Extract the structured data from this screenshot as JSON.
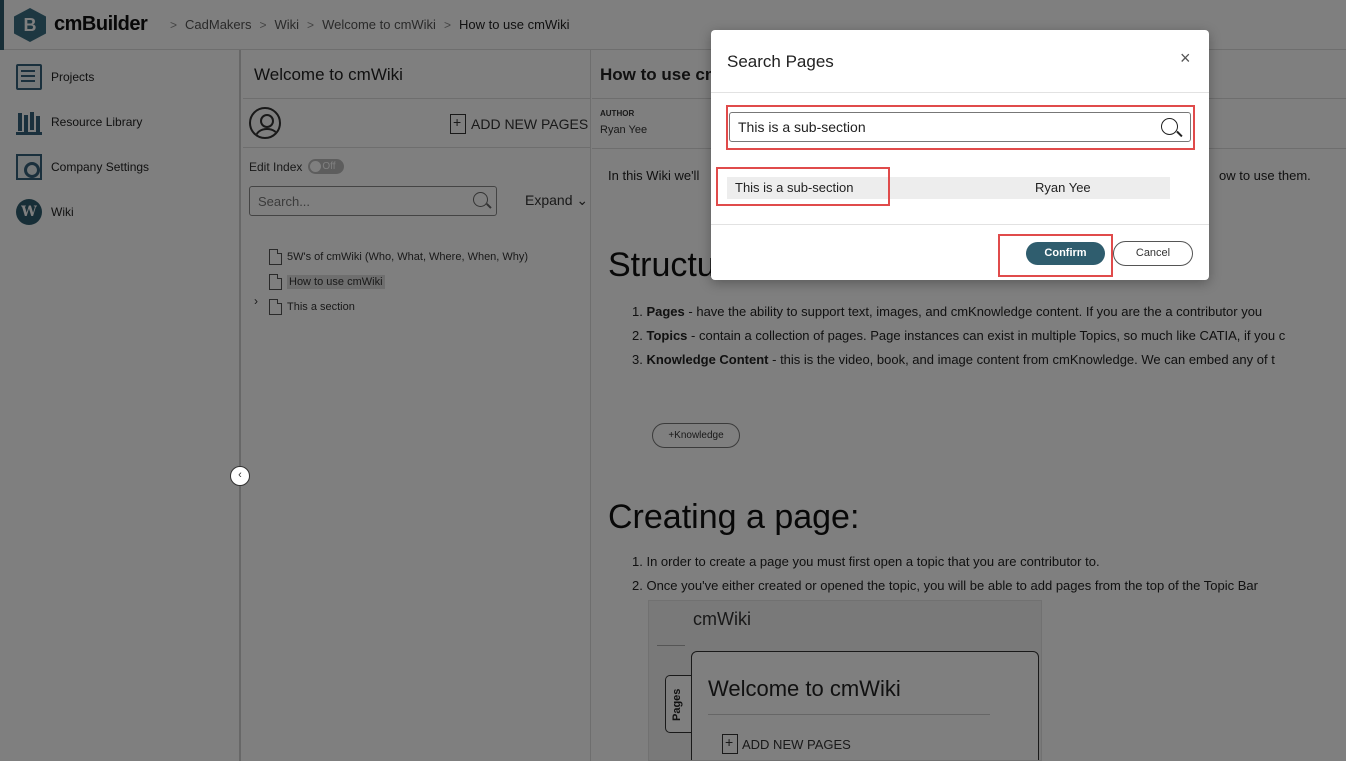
{
  "app": {
    "logo_letter": "B",
    "logo_text": "cmBuilder"
  },
  "breadcrumb": [
    "CadMakers",
    "Wiki",
    "Welcome to cmWiki",
    "How to use cmWiki"
  ],
  "sidebar": {
    "items": [
      {
        "label": "Projects",
        "icon": "projects-icon"
      },
      {
        "label": "Resource Library",
        "icon": "library-icon"
      },
      {
        "label": "Company Settings",
        "icon": "settings-icon"
      },
      {
        "label": "Wiki",
        "icon": "wiki-icon",
        "icon_letter": "W"
      }
    ],
    "collapse_glyph": "‹"
  },
  "topic": {
    "title": "Welcome to cmWiki",
    "add_pages_label": "ADD NEW PAGES",
    "edit_index_label": "Edit Index",
    "toggle_label": "Off",
    "search_placeholder": "Search...",
    "expand_label": "Expand",
    "expand_glyph": "⌄",
    "tree": [
      {
        "label": "5W's of cmWiki (Who, What, Where, When, Why)",
        "active": false
      },
      {
        "label": "How to use cmWiki",
        "active": true
      },
      {
        "label": "This a section",
        "active": false,
        "has_children": true
      }
    ],
    "tree_chevron": "›"
  },
  "page": {
    "title": "How to use cmWiki",
    "author_label": "AUTHOR",
    "author_name": "Ryan Yee",
    "intro_start": "In this Wiki we'll",
    "intro_end": "ow to use them.",
    "structure_heading": "Structure",
    "structure_items": [
      {
        "bold": "Pages",
        "text": " - have the ability to support text, images, and cmKnowledge content. If you are the a contributor you"
      },
      {
        "bold": "Topics",
        "text": " - contain a collection of pages. Page instances can exist in multiple Topics, so much like CATIA, if you c"
      },
      {
        "bold": "Knowledge Content",
        "text": " - this is the video, book, and image content from cmKnowledge. We can embed any of t"
      }
    ],
    "knowledge_button": "+Knowledge",
    "creating_heading": "Creating a page:",
    "creating_items": [
      "In order to create a page you must first open a topic that you are contributor to.",
      "Once you've either created or opened the topic, you will be able to add pages from the top of the Topic Bar"
    ],
    "embed": {
      "app_title": "cmWiki",
      "card_title": "Welcome to cmWiki",
      "add_pages_label": "ADD NEW PAGES",
      "tab_label": "Pages"
    }
  },
  "modal": {
    "title": "Search Pages",
    "close_glyph": "×",
    "search_value": "This is a sub-section",
    "results": [
      {
        "name": "This is a sub-section",
        "author": "Ryan Yee"
      }
    ],
    "confirm_label": "Confirm",
    "cancel_label": "Cancel"
  },
  "colors": {
    "accent": "#2f5d6e",
    "highlight": "#e04b4b",
    "overlay": "rgba(0,0,0,0.5)"
  }
}
